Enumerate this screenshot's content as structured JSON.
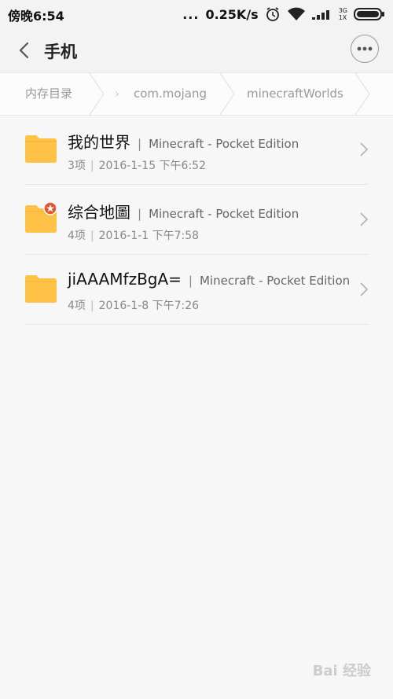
{
  "status_bar": {
    "time": "傍晚6:54",
    "dots": "...",
    "speed": "0.25K/s",
    "net_top": "3G",
    "net_bottom": "1X"
  },
  "header": {
    "title": "手机"
  },
  "breadcrumb": {
    "items": [
      "内存目录",
      "com.mojang",
      "minecraftWorlds"
    ]
  },
  "files": [
    {
      "name": "我的世界",
      "app": "Minecraft - Pocket Edition",
      "count": "3项",
      "date": "2016-1-15 下午6:52",
      "badge": false
    },
    {
      "name": "综合地圖",
      "app": "Minecraft - Pocket Edition",
      "count": "4项",
      "date": "2016-1-1 下午7:58",
      "badge": true
    },
    {
      "name": "jiAAAMfzBgA=",
      "app": "Minecraft - Pocket Edition",
      "count": "4项",
      "date": "2016-1-8 下午7:26",
      "badge": false
    }
  ],
  "watermark": "Bai 经验",
  "colors": {
    "folder": "#ffc247",
    "folder_dark": "#f5b02e",
    "badge": "#e5542a"
  }
}
